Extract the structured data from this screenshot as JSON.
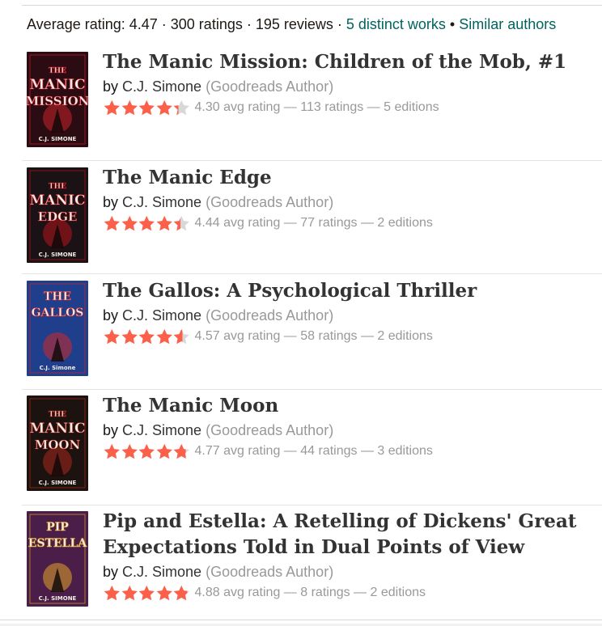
{
  "stats": {
    "text": "Average rating: 4.47 · 300 ratings · 195 reviews · ",
    "works_link": "5 distinct works",
    "separator": " • ",
    "similar_link": "Similar authors"
  },
  "colors": {
    "star": "#fa604a",
    "star_empty": "#d8d8d8",
    "link": "#00635d"
  },
  "books": [
    {
      "title": "The Manic Mission: Children of the Mob, #1",
      "by": "by",
      "author": "C.J. Simone",
      "author_tag": "(Goodreads Author)",
      "rating_text": "4.30 avg rating — 113 ratings — 5 editions",
      "rating": 4.3,
      "cover": {
        "line1": "THE",
        "line2": "MANIC",
        "line3": "MISSION",
        "bottom": "C.J. SIMONE",
        "bg": "#2a0c12",
        "accent": "#c8202a"
      }
    },
    {
      "title": "The Manic Edge",
      "by": "by",
      "author": "C.J. Simone",
      "author_tag": "(Goodreads Author)",
      "rating_text": "4.44 avg rating — 77 ratings — 2 editions",
      "rating": 4.44,
      "cover": {
        "line1": "THE",
        "line2": "MANIC",
        "line3": "EDGE",
        "bottom": "C.J. SIMONE",
        "bg": "#1a1214",
        "accent": "#b8141c"
      }
    },
    {
      "title": "The Gallos: A Psychological Thriller",
      "by": "by",
      "author": "C.J. Simone",
      "author_tag": "(Goodreads Author)",
      "rating_text": "4.57 avg rating — 58 ratings — 2 editions",
      "rating": 4.57,
      "cover": {
        "line1": "THE",
        "line2": "GALLOS",
        "line3": "",
        "bottom": "C.J. Simone",
        "bg": "#1f3f8c",
        "accent": "#d02828"
      }
    },
    {
      "title": "The Manic Moon",
      "by": "by",
      "author": "C.J. Simone",
      "author_tag": "(Goodreads Author)",
      "rating_text": "4.77 avg rating — 44 ratings — 3 editions",
      "rating": 4.77,
      "cover": {
        "line1": "THE",
        "line2": "MANIC",
        "line3": "MOON",
        "bottom": "C.J. SIMONE",
        "bg": "#1c1210",
        "accent": "#a8281c"
      }
    },
    {
      "title": "Pip and Estella: A Retelling of Dickens' Great Expectations Told in Dual Points of View",
      "by": "by",
      "author": "C.J. Simone",
      "author_tag": "(Goodreads Author)",
      "rating_text": "4.88 avg rating — 8 ratings — 2 editions",
      "rating": 4.88,
      "cover": {
        "line1": "PIP",
        "line2": "ESTELLA",
        "line3": "",
        "bottom": "C.J. SIMONE",
        "bg": "#4a1e48",
        "accent": "#e0a22a"
      }
    }
  ]
}
